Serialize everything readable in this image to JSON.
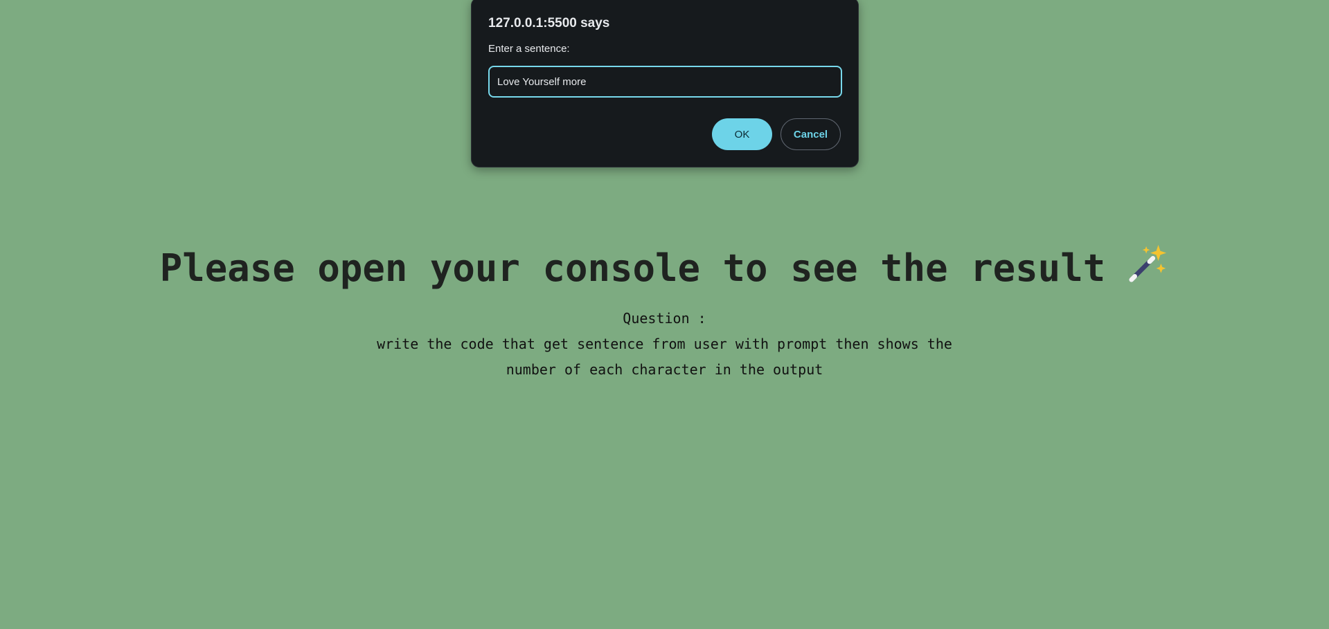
{
  "dialog": {
    "title": "127.0.0.1:5500 says",
    "message": "Enter a sentence:",
    "input_value": "Love Yourself more",
    "ok_label": "OK",
    "cancel_label": "Cancel"
  },
  "page": {
    "heading": "Please open your console to see the result",
    "heading_icon": "magic-wand-icon",
    "question_label": "Question :",
    "question_line_1": "write the code that get sentence from user with prompt then shows the",
    "question_line_2": "number of each character in the output"
  },
  "colors": {
    "background": "#7dab81",
    "dialog_background": "#161a1d",
    "accent": "#6dd3e8"
  }
}
